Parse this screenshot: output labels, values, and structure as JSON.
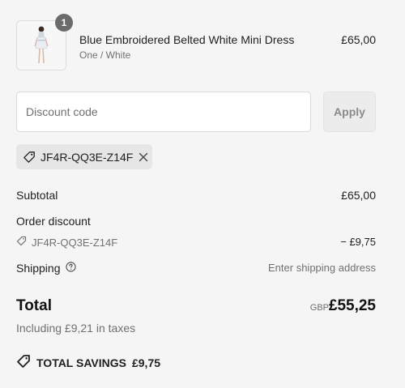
{
  "product": {
    "quantity": "1",
    "name": "Blue Embroidered Belted White Mini Dress",
    "variant": "One / White",
    "price": "£65,00"
  },
  "discount": {
    "placeholder": "Discount code",
    "apply_label": "Apply",
    "applied_code": "JF4R-QQ3E-Z14F"
  },
  "summary": {
    "subtotal_label": "Subtotal",
    "subtotal_value": "£65,00",
    "order_discount_label": "Order discount",
    "discount_code": "JF4R-QQ3E-Z14F",
    "discount_value": "− £9,75",
    "shipping_label": "Shipping",
    "shipping_value": "Enter shipping address",
    "total_label": "Total",
    "total_currency": "GBP",
    "total_value": "£55,25",
    "tax_note": "Including £9,21 in taxes",
    "savings_label": "TOTAL SAVINGS",
    "savings_value": "£9,75"
  }
}
